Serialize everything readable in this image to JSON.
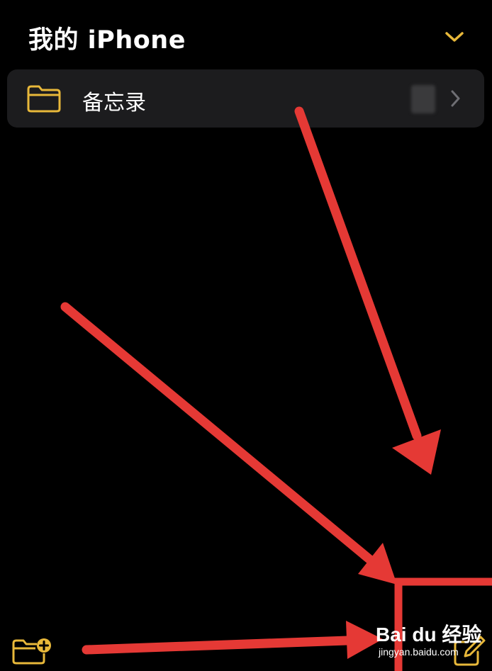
{
  "header": {
    "title": "我的 iPhone",
    "collapse_icon": "chevron-down-icon"
  },
  "folder": {
    "label": "备忘录",
    "count": "",
    "icon": "folder-icon",
    "disclosure_icon": "chevron-right-icon"
  },
  "toolbar": {
    "new_folder_icon": "folder-plus-icon",
    "compose_icon": "compose-icon"
  },
  "watermark": {
    "logo": "Bai du 经验",
    "url": "jingyan.baidu.com"
  },
  "colors": {
    "background": "#000000",
    "row_background": "#1c1c1e",
    "accent": "#e8b83a",
    "annotation": "#e53935",
    "chevron_gray": "#6e6e73"
  }
}
